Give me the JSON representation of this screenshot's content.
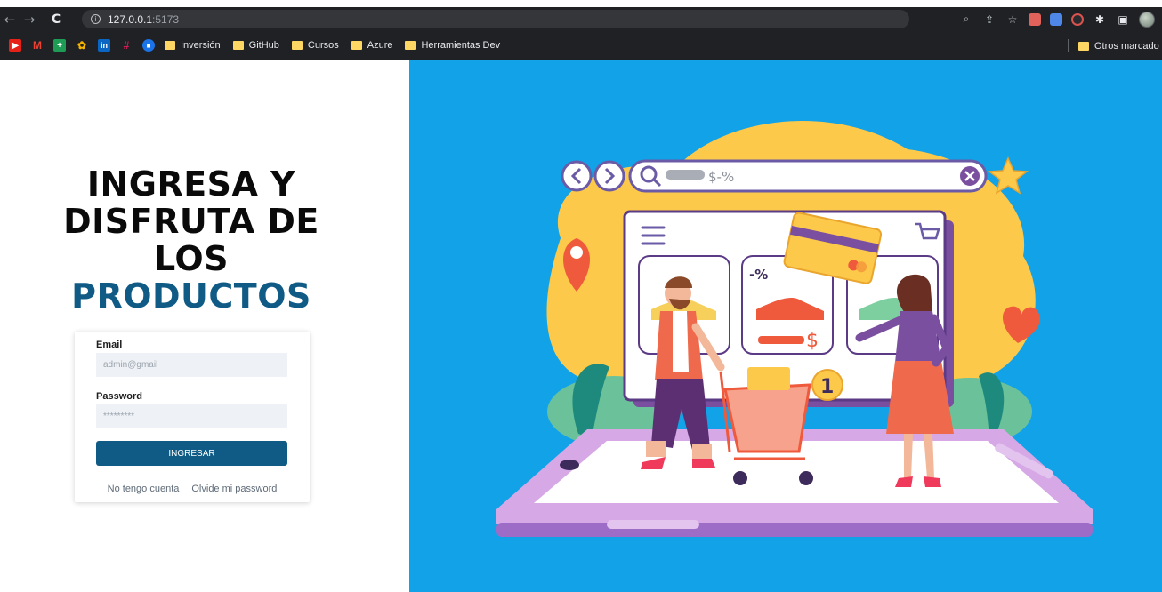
{
  "browser": {
    "url_host": "127.0.0.1",
    "url_port": ":5173",
    "bookmarks": [
      "Inversión",
      "GitHub",
      "Cursos",
      "Azure",
      "Herramientas Dev"
    ],
    "other_bookmarks": "Otros marcado"
  },
  "login": {
    "title_lines": [
      "INGRESA Y",
      "DISFRUTA DE",
      "LOS"
    ],
    "title_accent": "PRODUCTOS",
    "email_label": "Email",
    "email_placeholder": "admin@gmail",
    "password_label": "Password",
    "password_placeholder": "*********",
    "submit_label": "INGRESAR",
    "link_no_account": "No tengo cuenta",
    "link_forgot": "Olvide mi password"
  },
  "illustration": {
    "search_text": "$-%",
    "discount_tag": "-%",
    "price_symbol": "$",
    "cart_badge": "1"
  },
  "colors": {
    "accent": "#0f5b86",
    "hero_background": "#12a2e8"
  }
}
